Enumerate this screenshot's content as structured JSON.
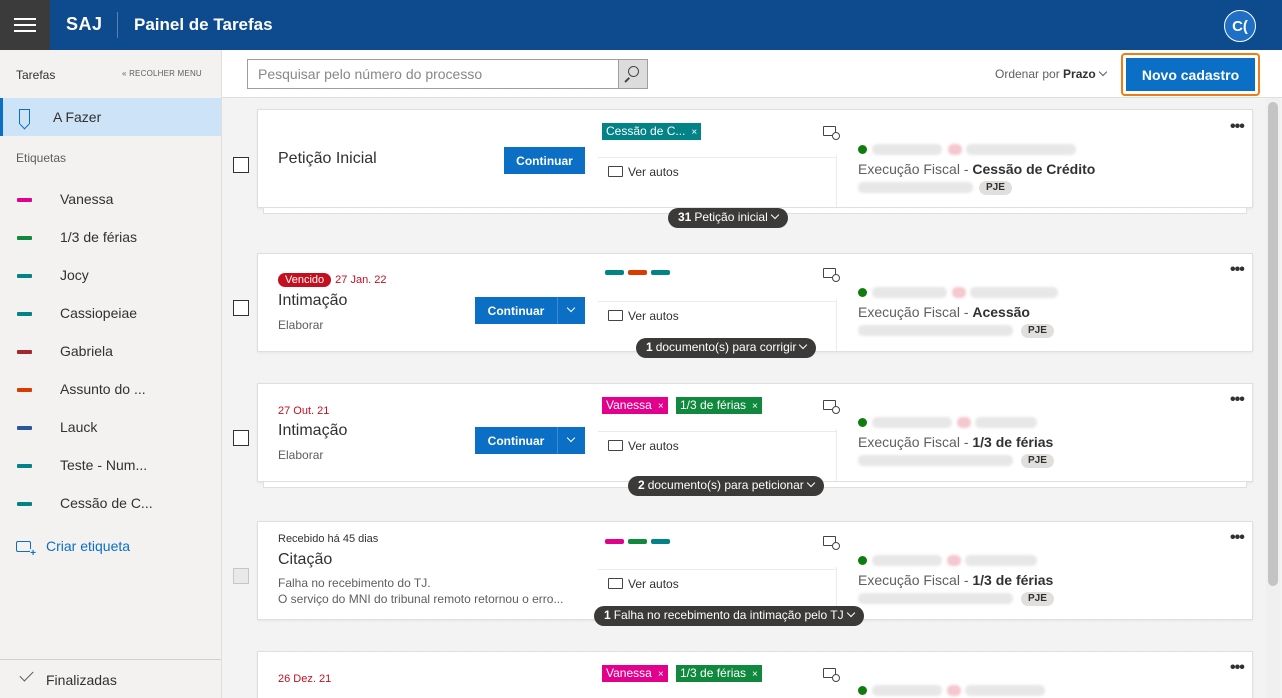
{
  "topbar": {
    "brand": "SAJ",
    "title": "Painel de Tarefas",
    "avatar_initials": "C("
  },
  "sidebar": {
    "header": "Tarefas",
    "collapse": "RECOLHER MENU",
    "active_item": "A Fazer",
    "tags_heading": "Etiquetas",
    "tags": [
      {
        "label": "Vanessa",
        "color": "#e3008c"
      },
      {
        "label": "1/3 de férias",
        "color": "#10893e"
      },
      {
        "label": "Jocy",
        "color": "#038387"
      },
      {
        "label": "Cassiopeiae",
        "color": "#038387"
      },
      {
        "label": "Gabriela",
        "color": "#a4262c"
      },
      {
        "label": "Assunto do ...",
        "color": "#da3b01"
      },
      {
        "label": "Lauck",
        "color": "#2b579a"
      },
      {
        "label": "Teste - Num...",
        "color": "#038387"
      },
      {
        "label": "Cessão de C...",
        "color": "#038387"
      }
    ],
    "create_tag": "Criar etiqueta",
    "footer": "Finalizadas"
  },
  "toolbar": {
    "search_placeholder": "Pesquisar pelo número do processo",
    "sort_prefix": "Ordenar por",
    "sort_value": "Prazo",
    "new_button": "Novo cadastro"
  },
  "common": {
    "ver_autos": "Ver autos",
    "continuar": "Continuar",
    "pje": "PJE",
    "remove": "×"
  },
  "cards": [
    {
      "title": "Petição Inicial",
      "tag_chip": "Cessão de C...",
      "class_prefix": "Execução Fiscal - ",
      "class_subject": "Cessão de Crédito",
      "pill_count": "31",
      "pill_text": "Petição inicial"
    },
    {
      "badge": "Vencido",
      "deadline": "27 Jan. 22",
      "title": "Intimação",
      "subtitle": "Elaborar",
      "class_prefix": "Execução Fiscal - ",
      "class_subject": "Acessão",
      "pill_count": "1",
      "pill_text": "documento(s) para corrigir"
    },
    {
      "deadline": "27 Out. 21",
      "title": "Intimação",
      "subtitle": "Elaborar",
      "tag_chips": [
        "Vanessa",
        "1/3 de férias"
      ],
      "class_prefix": "Execução Fiscal - ",
      "class_subject": "1/3 de férias",
      "pill_count": "2",
      "pill_text": "documento(s) para peticionar"
    },
    {
      "received": "Recebido há 45 dias",
      "title": "Citação",
      "error_1": "Falha no recebimento do TJ.",
      "error_2": "O serviço do MNI do tribunal remoto retornou o erro...",
      "class_prefix": "Execução Fiscal - ",
      "class_subject": "1/3 de férias",
      "pill_count": "1",
      "pill_text": "Falha no recebimento da intimação pelo TJ"
    },
    {
      "deadline": "26 Dez. 21",
      "tag_chips": [
        "Vanessa",
        "1/3 de férias"
      ]
    }
  ],
  "colors": {
    "header": "#0d4b8e",
    "primary": "#0b6fc5",
    "highlight": "#f07c16",
    "danger": "#c50f1f",
    "tag_vanessa": "#e3008c",
    "tag_ferias": "#10893e",
    "tag_teal": "#038387",
    "tag_orange": "#da3b01"
  }
}
